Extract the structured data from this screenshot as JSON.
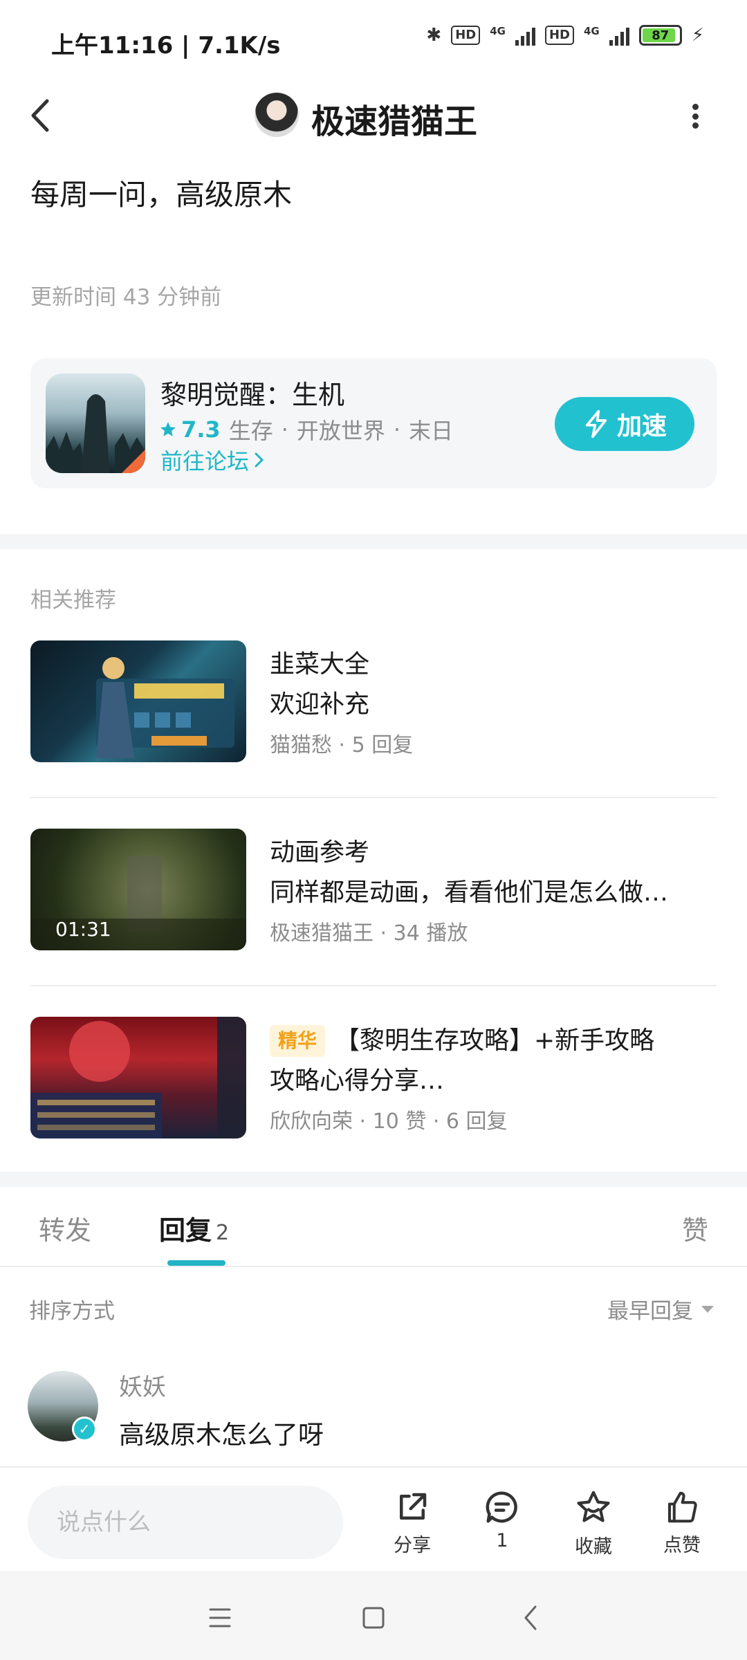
{
  "status_bar": {
    "time_speed": "上午11:16 | 7.1K/s",
    "hd_label": "HD",
    "network": "4G",
    "battery": "87"
  },
  "header": {
    "title": "极速猎猫王"
  },
  "post": {
    "title": "每周一问，高级原木",
    "update_time": "更新时间 43 分钟前"
  },
  "game_card": {
    "name": "黎明觉醒：生机",
    "rating": "7.3",
    "tags": [
      "生存",
      "开放世界",
      "末日"
    ],
    "forum_link": "前往论坛",
    "accelerate_button": "加速"
  },
  "related": {
    "title": "相关推荐",
    "items": [
      {
        "line1": "韭菜大全",
        "line2": "欢迎补充",
        "meta": "猫猫愁 · 5 回复"
      },
      {
        "line1": "动画参考",
        "line2": "同样都是动画，看看他们是怎么做…",
        "meta": "极速猎猫王 · 34 播放",
        "duration": "01:31"
      },
      {
        "badge": "精华",
        "line1": "【黎明生存攻略】+新手攻略",
        "line2": "攻略心得分享…",
        "meta": "欣欣向荣 · 10 赞 · 6 回复"
      }
    ]
  },
  "tabs": {
    "forward": "转发",
    "reply": "回复",
    "reply_count": "2",
    "like": "赞"
  },
  "sort": {
    "label": "排序方式",
    "value": "最早回复"
  },
  "reply": {
    "name": "妖妖",
    "content": "高级原木怎么了呀"
  },
  "bottom_bar": {
    "input_placeholder": "说点什么",
    "share": "分享",
    "comment_count": "1",
    "favorite": "收藏",
    "like": "点赞"
  },
  "colors": {
    "accent": "#22c1cf",
    "badge_bg": "#fff3d9",
    "badge_text": "#f0a21b",
    "battery": "#6ed64a"
  }
}
